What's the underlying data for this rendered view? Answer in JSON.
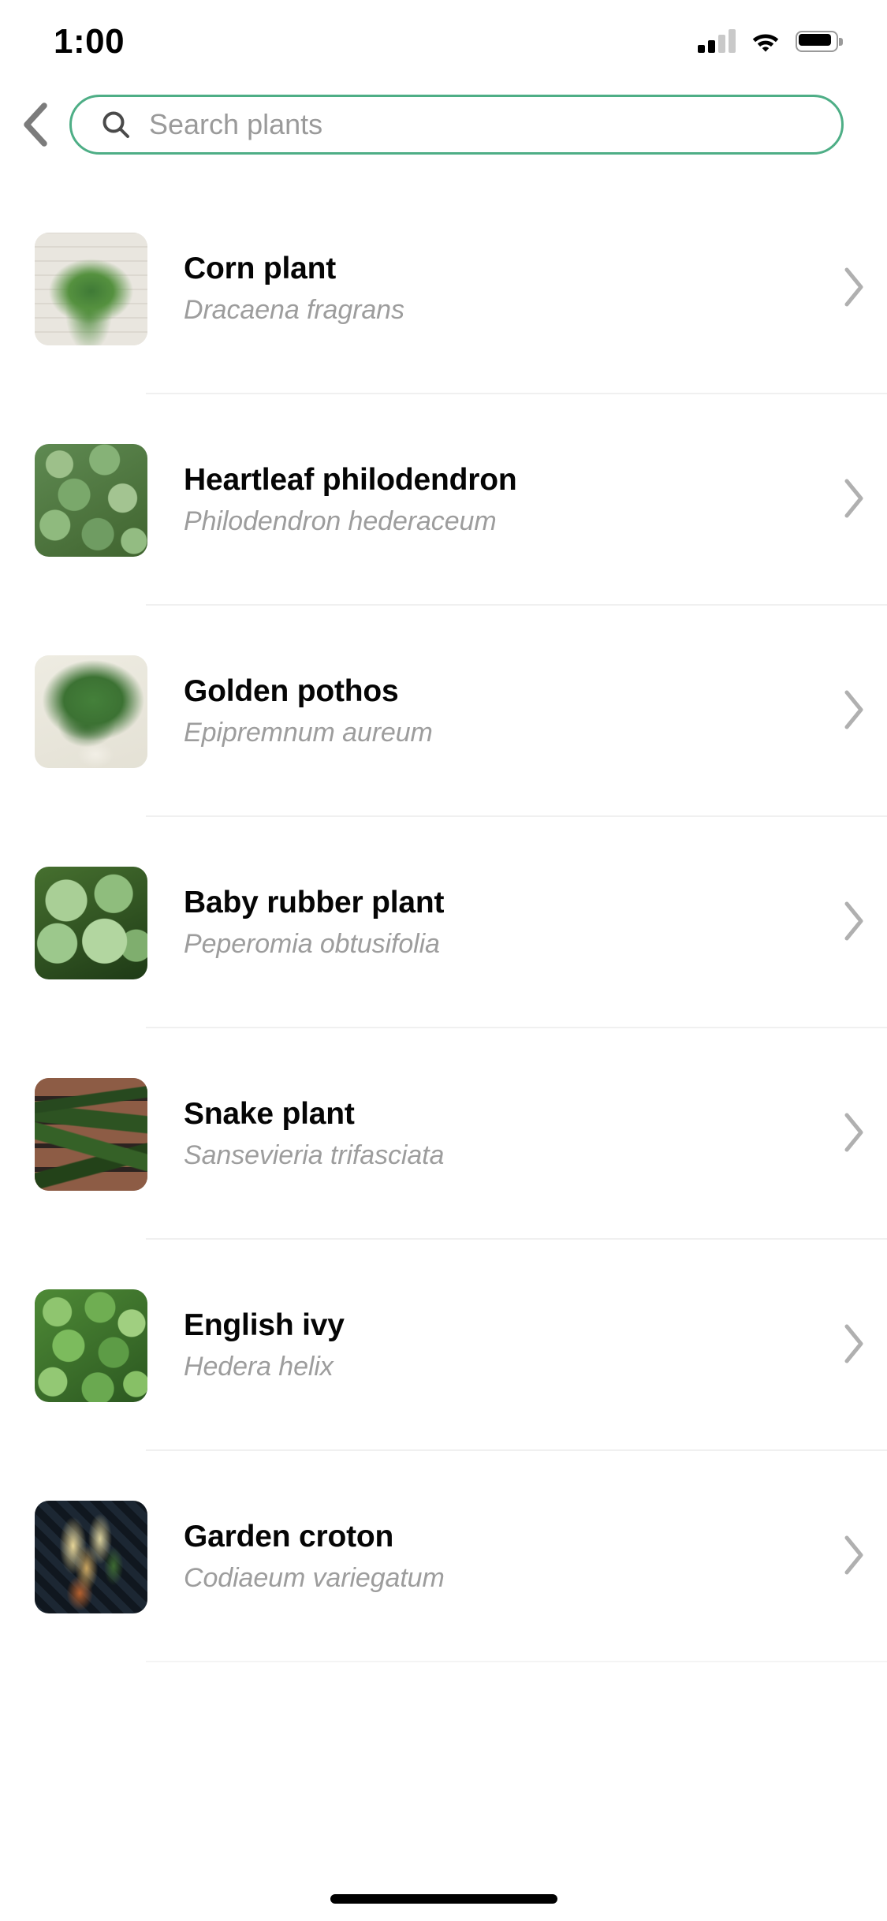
{
  "status_bar": {
    "time": "1:00",
    "cellular_icon": "cellular-signal-icon",
    "cellular_bars_filled": 2,
    "cellular_bars_total": 4,
    "wifi_icon": "wifi-icon",
    "battery_icon": "battery-icon",
    "battery_level_percent": 90
  },
  "header": {
    "back_icon": "chevron-left-icon",
    "search": {
      "icon": "search-icon",
      "value": "",
      "placeholder": "Search plants",
      "border_color": "#4EAE86"
    }
  },
  "list": {
    "chevron_icon": "chevron-right-icon",
    "items": [
      {
        "common_name": "Corn plant",
        "scientific_name": "Dracaena fragrans",
        "thumbnail_name": "corn-plant-thumbnail",
        "art_class": "art-corn"
      },
      {
        "common_name": "Heartleaf philodendron",
        "scientific_name": "Philodendron hederaceum",
        "thumbnail_name": "heartleaf-philodendron-thumbnail",
        "art_class": "art-philo"
      },
      {
        "common_name": "Golden pothos",
        "scientific_name": "Epipremnum aureum",
        "thumbnail_name": "golden-pothos-thumbnail",
        "art_class": "art-pothos"
      },
      {
        "common_name": "Baby rubber plant",
        "scientific_name": "Peperomia obtusifolia",
        "thumbnail_name": "baby-rubber-plant-thumbnail",
        "art_class": "art-baby"
      },
      {
        "common_name": "Snake plant",
        "scientific_name": "Sansevieria trifasciata",
        "thumbnail_name": "snake-plant-thumbnail",
        "art_class": "art-snake"
      },
      {
        "common_name": "English ivy",
        "scientific_name": "Hedera helix",
        "thumbnail_name": "english-ivy-thumbnail",
        "art_class": "art-ivy"
      },
      {
        "common_name": "Garden croton",
        "scientific_name": "Codiaeum variegatum",
        "thumbnail_name": "garden-croton-thumbnail",
        "art_class": "art-croton"
      }
    ]
  },
  "home_indicator": "home-indicator"
}
